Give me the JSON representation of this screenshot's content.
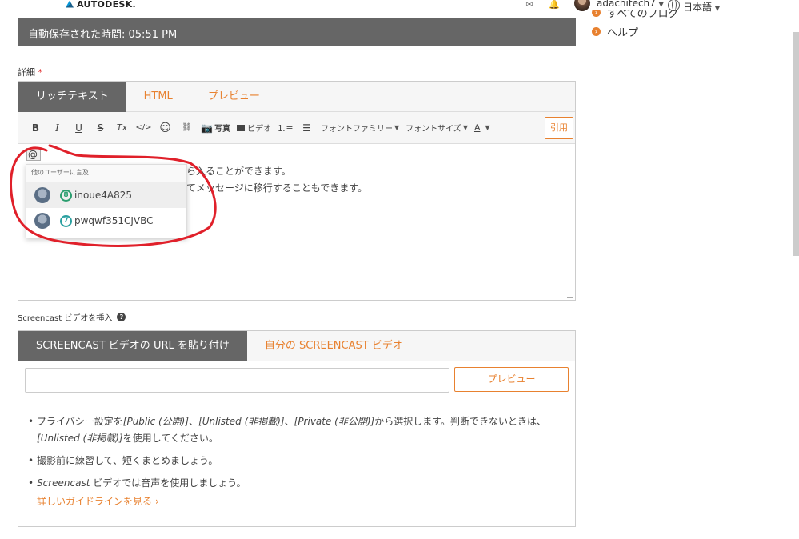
{
  "header": {
    "logo_text": "AUTODESK.",
    "user_name": "adachitech7",
    "language": "日本語"
  },
  "right_panel": {
    "items": [
      {
        "label": "すべてのブログ"
      },
      {
        "label": "ヘルプ"
      }
    ]
  },
  "autosave": {
    "text": "自動保存された時間: 05:51 PM"
  },
  "details": {
    "label": "詳細",
    "required_mark": "*"
  },
  "editor": {
    "tabs": [
      {
        "label": "リッチテキスト",
        "active": true
      },
      {
        "label": "HTML",
        "active": false
      },
      {
        "label": "プレビュー",
        "active": false
      }
    ],
    "toolbar": {
      "bold": "B",
      "italic": "I",
      "underline": "U",
      "strike": "S",
      "clear": "Tx",
      "code": "</>",
      "emoji": "☺",
      "link": "🔗",
      "photo": "写真",
      "video": "ビデオ",
      "font_family": "フォントファミリー",
      "font_size": "フォントサイズ",
      "font_color": "A",
      "quote": "引用"
    },
    "at_input": "@",
    "body_lines": [
      "ら入ることができます。",
      "てメッセージに移行することもできます。"
    ]
  },
  "mention_popup": {
    "header": "他のユーザーに言及...",
    "users": [
      {
        "rank": "8",
        "name": "inoue4A825"
      },
      {
        "rank": "7",
        "name": "pwqwf351CJVBC"
      }
    ]
  },
  "screencast": {
    "label": "Screencast ビデオを挿入",
    "tabs": [
      {
        "label": "SCREENCAST ビデオの URL を貼り付け",
        "active": true
      },
      {
        "label": "自分の SCREENCAST ビデオ",
        "active": false
      }
    ],
    "url_placeholder": "",
    "preview_button": "プレビュー",
    "bullets": [
      {
        "parts": [
          "プライバシー設定を",
          "[Public (公開)]",
          "、",
          "[Unlisted (非掲載)]",
          "、",
          "[Private (非公開)]",
          "から選択します。判断できないときは、"
        ],
        "second_line": [
          "[Unlisted (非掲載)]",
          "を使用してください。"
        ]
      },
      {
        "text": "撮影前に練習して、短くまとめましょう。"
      },
      {
        "italic": "Screencast",
        "text": " ビデオでは音声を使用しましょう。"
      }
    ],
    "guide_link": "詳しいガイドラインを見る ›"
  },
  "colors": {
    "accent": "#e8812f",
    "dark_bar": "#666666",
    "annotation": "#e0202a"
  }
}
